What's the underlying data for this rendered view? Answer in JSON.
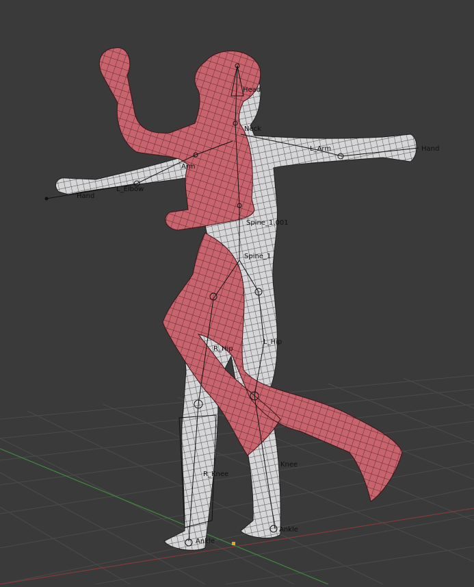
{
  "viewport": {
    "background": "#3a3a3a",
    "grid_color": "#4a4a4a",
    "x_axis_color": "#8a3a3a",
    "y_axis_color": "#3f8a3f",
    "origin_color": "#f0a020"
  },
  "meshes": {
    "posed_color": "#c8646e",
    "posed_edge_color": "#3a1418",
    "rest_color": "#d6d6d8",
    "rest_edge_color": "#1e1e1e"
  },
  "bone_labels": [
    {
      "id": "head",
      "text": "Head"
    },
    {
      "id": "neck",
      "text": "Neck"
    },
    {
      "id": "l-arm",
      "text": "L_Arm"
    },
    {
      "id": "r-hand-right",
      "text": "Hand"
    },
    {
      "id": "r-arm",
      "text": "Arm"
    },
    {
      "id": "l-elbow",
      "text": "L_Elbow"
    },
    {
      "id": "l-hand",
      "text": "Hand"
    },
    {
      "id": "spine-1-001",
      "text": "Spine_1.001"
    },
    {
      "id": "spine-1",
      "text": "Spine_1"
    },
    {
      "id": "l-hip",
      "text": "L_Hip"
    },
    {
      "id": "r-hip",
      "text": "R_Hip"
    },
    {
      "id": "r-knee",
      "text": "R_Knee"
    },
    {
      "id": "l-knee",
      "text": "Knee"
    },
    {
      "id": "l-ankle",
      "text": "Ankle"
    },
    {
      "id": "r-ankle",
      "text": "Ankle"
    }
  ]
}
